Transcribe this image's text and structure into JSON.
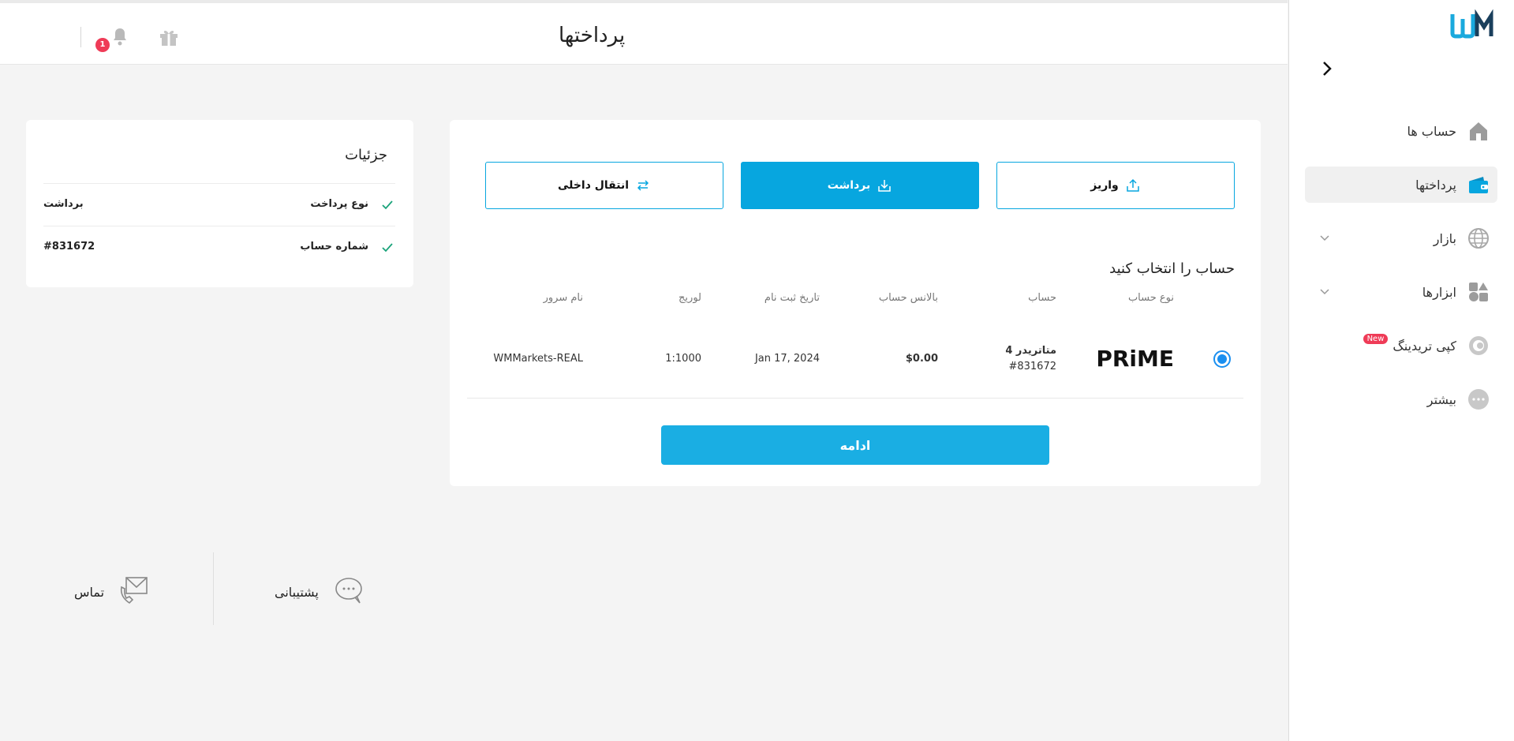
{
  "header": {
    "title": "پرداختها",
    "notification_count": "1"
  },
  "sidebar": {
    "items": [
      {
        "label": "حساب ها",
        "icon": "home-icon"
      },
      {
        "label": "پرداختها",
        "icon": "wallet-icon",
        "active": true
      },
      {
        "label": "بازار",
        "icon": "globe-icon"
      },
      {
        "label": "ابزارها",
        "icon": "tools-icon"
      },
      {
        "label": "کپی تریدینگ",
        "icon": "copy-trading-icon",
        "badge": "New"
      },
      {
        "label": "بیشتر",
        "icon": "more-icon"
      }
    ]
  },
  "tabs": {
    "deposit": "واریز",
    "withdraw": "برداشت",
    "transfer": "انتقال داخلی"
  },
  "account_select": {
    "title": "حساب را انتخاب کنید",
    "columns": [
      "نوع حساب",
      "حساب",
      "بالانس حساب",
      "تاریخ ثبت نام",
      "لوریج",
      "نام سرور"
    ],
    "row": {
      "type": "PRiME",
      "platform": "متاتریدر 4",
      "number": "#831672",
      "balance": "$0.00",
      "registered": "Jan 17, 2024",
      "leverage": "1:1000",
      "server": "WMMarkets-REAL"
    },
    "continue_label": "ادامه"
  },
  "details": {
    "title": "جزئیات",
    "rows": [
      {
        "label": "نوع پرداخت",
        "value": "برداشت"
      },
      {
        "label": "شماره حساب",
        "value": "#831672"
      }
    ]
  },
  "footer": {
    "support": "پشتیبانی",
    "contact": "تماس"
  },
  "colors": {
    "accent": "#07a6df",
    "badge": "#ef3b57",
    "check": "#1aa37a"
  }
}
